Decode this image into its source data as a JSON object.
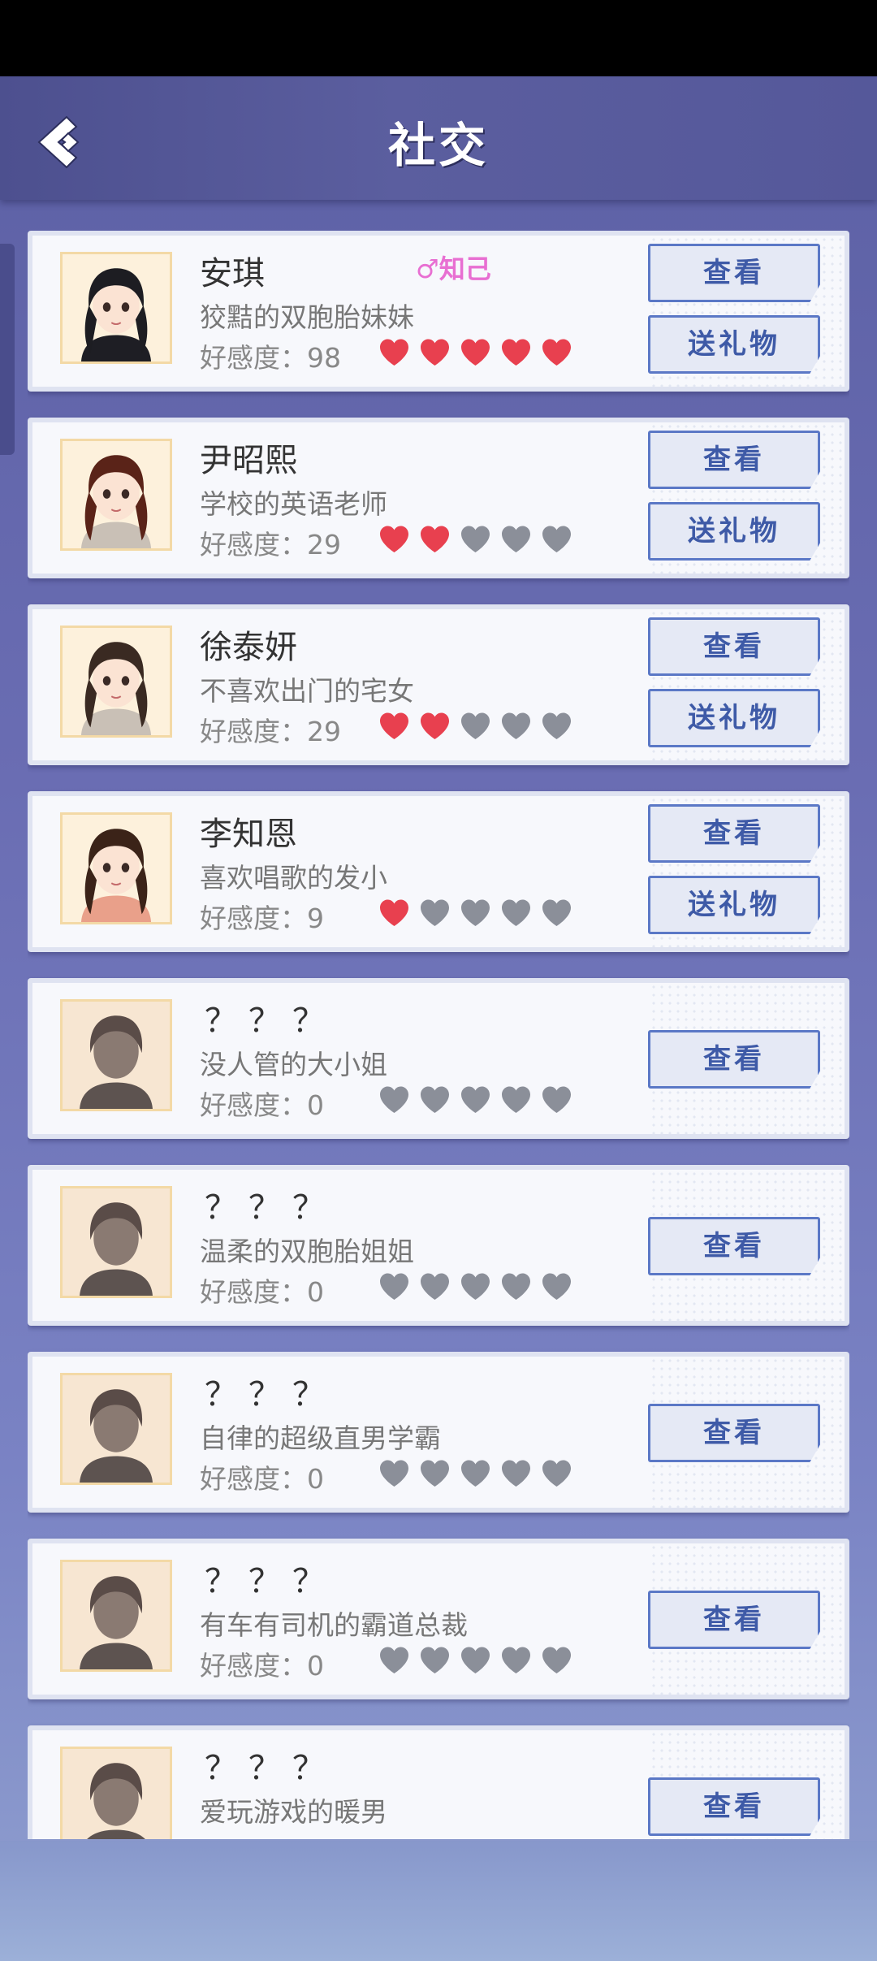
{
  "header": {
    "title": "社交"
  },
  "characters": [
    {
      "name": "安琪",
      "desc": "狡黠的双胞胎妹妹",
      "affection_label": "好感度：98",
      "affection": 98,
      "hearts_filled": 5,
      "tag": "♂知己",
      "view": "查看",
      "gift": "送礼物",
      "unlocked": true
    },
    {
      "name": "尹昭熙",
      "desc": "学校的英语老师",
      "affection_label": "好感度：29",
      "affection": 29,
      "hearts_filled": 2,
      "view": "查看",
      "gift": "送礼物",
      "unlocked": true
    },
    {
      "name": "徐泰妍",
      "desc": "不喜欢出门的宅女",
      "affection_label": "好感度：29",
      "affection": 29,
      "hearts_filled": 2,
      "view": "查看",
      "gift": "送礼物",
      "unlocked": true
    },
    {
      "name": "李知恩",
      "desc": "喜欢唱歌的发小",
      "affection_label": "好感度：9",
      "affection": 9,
      "hearts_filled": 1,
      "view": "查看",
      "gift": "送礼物",
      "unlocked": true
    },
    {
      "name": "？？？",
      "desc": "没人管的大小姐",
      "affection_label": "好感度：0",
      "affection": 0,
      "hearts_filled": 0,
      "view": "查看",
      "unlocked": false
    },
    {
      "name": "？？？",
      "desc": "温柔的双胞胎姐姐",
      "affection_label": "好感度：0",
      "affection": 0,
      "hearts_filled": 0,
      "view": "查看",
      "unlocked": false
    },
    {
      "name": "？？？",
      "desc": "自律的超级直男学霸",
      "affection_label": "好感度：0",
      "affection": 0,
      "hearts_filled": 0,
      "view": "查看",
      "unlocked": false
    },
    {
      "name": "？？？",
      "desc": "有车有司机的霸道总裁",
      "affection_label": "好感度：0",
      "affection": 0,
      "hearts_filled": 0,
      "view": "查看",
      "unlocked": false
    },
    {
      "name": "？？？",
      "desc": "爱玩游戏的暖男",
      "view": "查看",
      "unlocked": false
    }
  ],
  "max_hearts": 5,
  "colors": {
    "heart_filled": "#e8404f",
    "heart_empty": "#8b8f99",
    "button_border": "#5b78c6",
    "button_text": "#3e5aa7",
    "tag": "#e86fd2"
  },
  "icons": {
    "back": "back-chevron-icon",
    "heart": "heart-icon"
  }
}
